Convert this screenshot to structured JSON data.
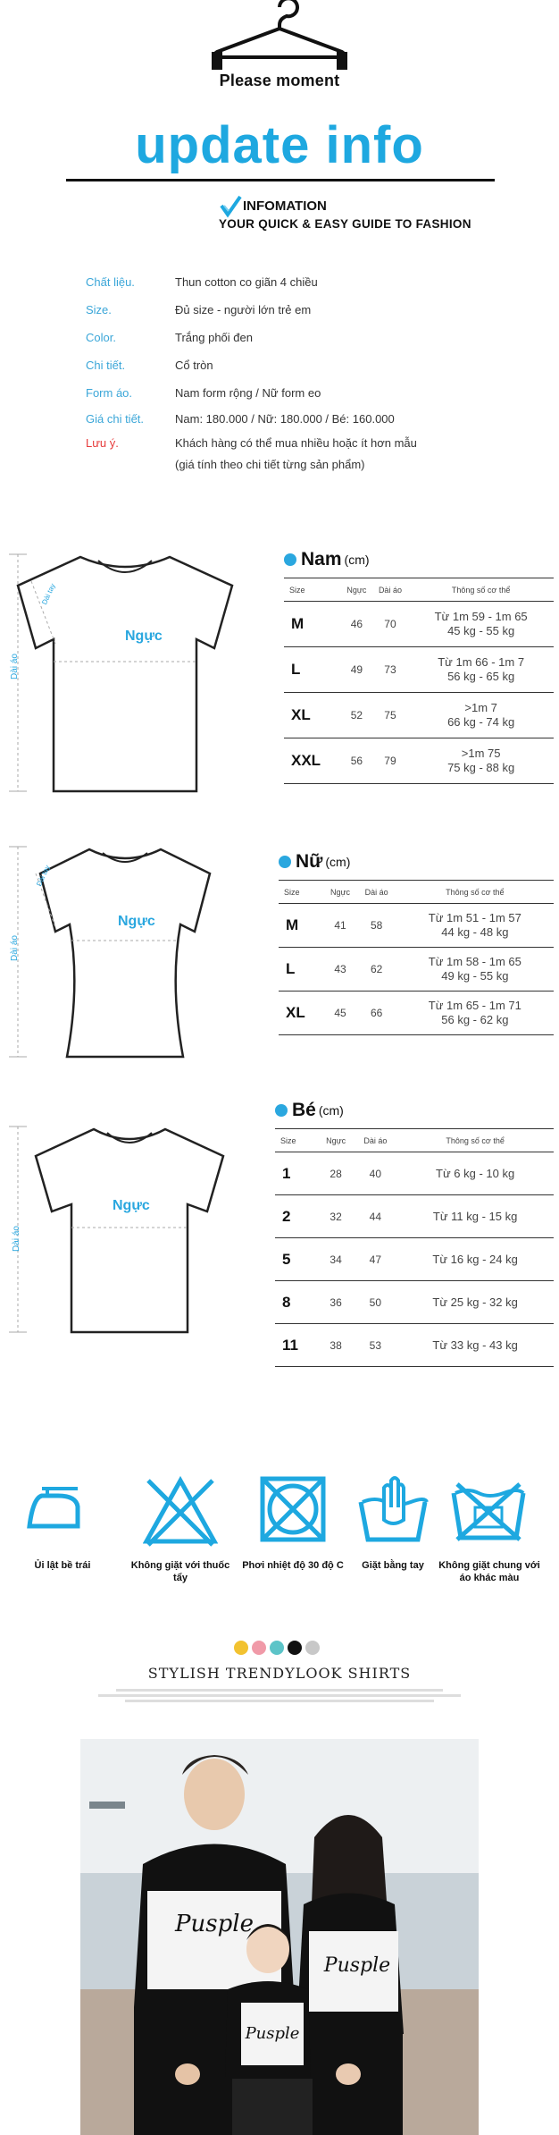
{
  "header": {
    "please": "Please moment",
    "update": "update info",
    "info_title": "INFOMATION",
    "info_sub": "YOUR QUICK & EASY GUIDE TO FASHION"
  },
  "spec": [
    {
      "k": "Chất liệu.",
      "v": "Thun cotton co giãn 4 chiều"
    },
    {
      "k": "Size.",
      "v": "Đủ size - người lớn trẻ em"
    },
    {
      "k": "Color.",
      "v": "Trắng phối đen"
    },
    {
      "k": "Chi tiết.",
      "v": "Cổ tròn"
    },
    {
      "k": "Form áo.",
      "v": "Nam form rộng / Nữ form eo"
    },
    {
      "k": "Giá chi tiết.",
      "v": "Nam: 180.000 / Nữ: 180.000 / Bé: 160.000"
    },
    {
      "k": "Lưu ý.",
      "v": "Khách hàng có thể mua nhiều hoặc ít hơn mẫu"
    },
    {
      "k": "",
      "v": "(giá tính theo chi tiết từng sản phẩm)"
    }
  ],
  "labels": {
    "nguc": "Ngực",
    "dai_ao": "Dài áo",
    "dai_tay": "Dài tay"
  },
  "headers": {
    "size": "Size",
    "nguc": "Ngực",
    "dai_ao": "Dài áo",
    "thong_so": "Thông số cơ thể"
  },
  "nam": {
    "title": "Nam",
    "unit": "(cm)",
    "rows": [
      {
        "s": "M",
        "n": "46",
        "d": "70",
        "p1": "Từ 1m 59 - 1m 65",
        "p2": "45 kg - 55 kg"
      },
      {
        "s": "L",
        "n": "49",
        "d": "73",
        "p1": "Từ 1m 66 - 1m 7",
        "p2": "56 kg - 65 kg"
      },
      {
        "s": "XL",
        "n": "52",
        "d": "75",
        "p1": ">1m 7",
        "p2": "66 kg - 74 kg"
      },
      {
        "s": "XXL",
        "n": "56",
        "d": "79",
        "p1": ">1m 75",
        "p2": "75 kg - 88 kg"
      }
    ]
  },
  "nu": {
    "title": "Nữ",
    "unit": "(cm)",
    "rows": [
      {
        "s": "M",
        "n": "41",
        "d": "58",
        "p1": "Từ 1m 51 - 1m 57",
        "p2": "44 kg - 48 kg"
      },
      {
        "s": "L",
        "n": "43",
        "d": "62",
        "p1": "Từ 1m 58 - 1m 65",
        "p2": "49 kg - 55 kg"
      },
      {
        "s": "XL",
        "n": "45",
        "d": "66",
        "p1": "Từ 1m 65 - 1m 71",
        "p2": "56 kg - 62 kg"
      }
    ]
  },
  "be": {
    "title": "Bé",
    "unit": "(cm)",
    "rows": [
      {
        "s": "1",
        "n": "28",
        "d": "40",
        "p1": "Từ 6 kg - 10 kg"
      },
      {
        "s": "2",
        "n": "32",
        "d": "44",
        "p1": "Từ  11 kg - 15 kg"
      },
      {
        "s": "5",
        "n": "34",
        "d": "47",
        "p1": "Từ  16 kg - 24 kg"
      },
      {
        "s": "8",
        "n": "36",
        "d": "50",
        "p1": "Từ 25 kg - 32 kg"
      },
      {
        "s": "11",
        "n": "38",
        "d": "53",
        "p1": "Từ 33 kg - 43 kg"
      }
    ]
  },
  "care": [
    {
      "icon": "iron-icon",
      "label": "Ủi lật bề trái"
    },
    {
      "icon": "no-bleach-icon",
      "label": "Không giặt với thuốc tẩy"
    },
    {
      "icon": "tumble-dry-icon",
      "label": "Phơi nhiệt độ 30 độ C"
    },
    {
      "icon": "hand-wash-icon",
      "label": "Giặt bằng tay"
    },
    {
      "icon": "no-mix-wash-icon",
      "label": "Không giặt chung với áo khác màu"
    }
  ],
  "swatches": [
    "#f2c230",
    "#f09aa8",
    "#5cc4c8",
    "#111111",
    "#c8c8c8"
  ],
  "accent": "#1ea8e0",
  "stylish": "STYLISH TRENDYLOOK SHIRTS",
  "shirt_print": {
    "adult": "Pusple",
    "kid": "Pusple"
  }
}
